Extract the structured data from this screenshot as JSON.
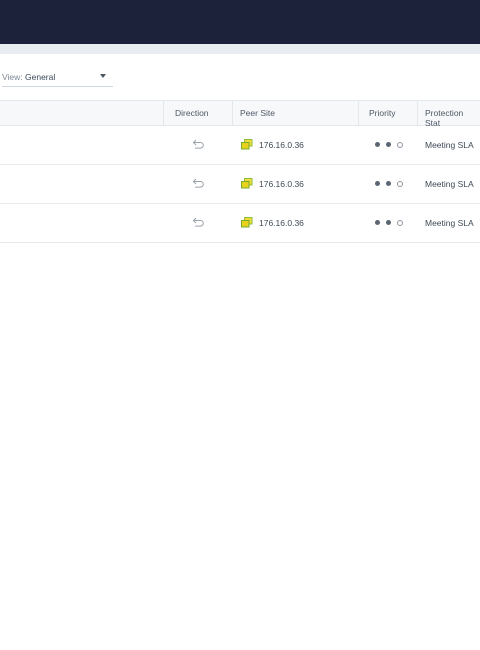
{
  "view": {
    "label": "View:",
    "value": "General"
  },
  "columns": {
    "direction": "Direction",
    "peer_site": "Peer Site",
    "priority": "Priority",
    "protection_status": "Protection Stat"
  },
  "rows": [
    {
      "peer_site": "176.16.0.36",
      "priority": 2,
      "status": "Meeting SLA"
    },
    {
      "peer_site": "176.16.0.36",
      "priority": 2,
      "status": "Meeting SLA"
    },
    {
      "peer_site": "176.16.0.36",
      "priority": 2,
      "status": "Meeting SLA"
    }
  ],
  "icons": {
    "direction": "return-arrow-icon",
    "site": "site-icon"
  },
  "colors": {
    "topbar": "#1c223a",
    "site_icon": "#e8d21c"
  }
}
